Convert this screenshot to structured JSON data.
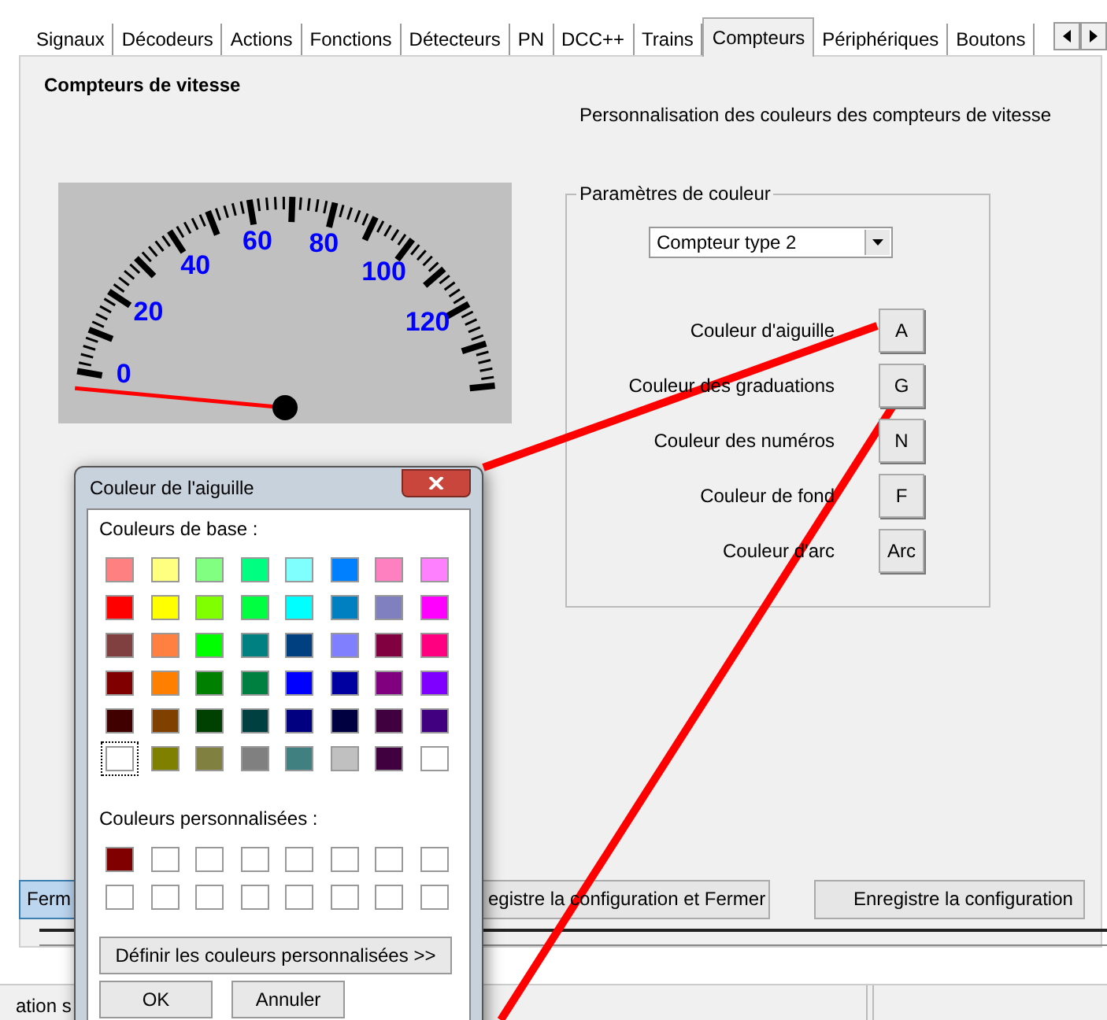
{
  "tabs": [
    {
      "label": "Signaux",
      "selected": false
    },
    {
      "label": "Décodeurs",
      "selected": false
    },
    {
      "label": "Actions",
      "selected": false
    },
    {
      "label": "Fonctions",
      "selected": false
    },
    {
      "label": "Détecteurs",
      "selected": false
    },
    {
      "label": "PN",
      "selected": false
    },
    {
      "label": "DCC++",
      "selected": false
    },
    {
      "label": "Trains",
      "selected": false
    },
    {
      "label": "Compteurs",
      "selected": true
    },
    {
      "label": "Périphériques",
      "selected": false
    },
    {
      "label": "Boutons",
      "selected": false
    }
  ],
  "page": {
    "title": "Compteurs de vitesse",
    "subtitle": "Personnalisation des couleurs des compteurs de vitesse"
  },
  "gauge": {
    "labels": [
      "0",
      "20",
      "40",
      "60",
      "80",
      "100",
      "120"
    ]
  },
  "color_group": {
    "legend": "Paramètres de couleur",
    "dropdown": "Compteur type 2",
    "rows": [
      {
        "label": "Couleur d'aiguille",
        "button": "A"
      },
      {
        "label": "Couleur des graduations",
        "button": "G"
      },
      {
        "label": "Couleur des numéros",
        "button": "N"
      },
      {
        "label": "Couleur  de fond",
        "button": "F"
      },
      {
        "label": "Couleur d'arc",
        "button": "Arc"
      }
    ]
  },
  "bottom_buttons": [
    {
      "label": "Ferm",
      "focused": true
    },
    {
      "label": "egistre la configuration et Fermer",
      "focused": false
    },
    {
      "label": "Enregistre la configuration",
      "focused": false
    }
  ],
  "status_bar": {
    "text": "ation s"
  },
  "dialog": {
    "title": "Couleur de l'aiguille",
    "base_label": "Couleurs de base :",
    "base_colors": [
      {
        "color": "#ff8080",
        "selected": false
      },
      {
        "color": "#ffff80",
        "selected": false
      },
      {
        "color": "#80ff80",
        "selected": false
      },
      {
        "color": "#00ff80",
        "selected": false
      },
      {
        "color": "#80ffff",
        "selected": false
      },
      {
        "color": "#0080ff",
        "selected": false
      },
      {
        "color": "#ff80c0",
        "selected": false
      },
      {
        "color": "#ff80ff",
        "selected": false
      },
      {
        "color": "#ff0000",
        "selected": false
      },
      {
        "color": "#ffff00",
        "selected": false
      },
      {
        "color": "#80ff00",
        "selected": false
      },
      {
        "color": "#00ff40",
        "selected": false
      },
      {
        "color": "#00ffff",
        "selected": false
      },
      {
        "color": "#0080c0",
        "selected": false
      },
      {
        "color": "#8080c0",
        "selected": false
      },
      {
        "color": "#ff00ff",
        "selected": false
      },
      {
        "color": "#804040",
        "selected": false
      },
      {
        "color": "#ff8040",
        "selected": false
      },
      {
        "color": "#00ff00",
        "selected": false
      },
      {
        "color": "#008080",
        "selected": false
      },
      {
        "color": "#004080",
        "selected": false
      },
      {
        "color": "#8080ff",
        "selected": false
      },
      {
        "color": "#800040",
        "selected": false
      },
      {
        "color": "#ff0080",
        "selected": false
      },
      {
        "color": "#800000",
        "selected": false
      },
      {
        "color": "#ff8000",
        "selected": false
      },
      {
        "color": "#008000",
        "selected": false
      },
      {
        "color": "#008040",
        "selected": false
      },
      {
        "color": "#0000ff",
        "selected": false
      },
      {
        "color": "#0000a0",
        "selected": false
      },
      {
        "color": "#800080",
        "selected": false
      },
      {
        "color": "#8000ff",
        "selected": false
      },
      {
        "color": "#400000",
        "selected": false
      },
      {
        "color": "#804000",
        "selected": false
      },
      {
        "color": "#004000",
        "selected": false
      },
      {
        "color": "#004040",
        "selected": false
      },
      {
        "color": "#000080",
        "selected": false
      },
      {
        "color": "#000040",
        "selected": false
      },
      {
        "color": "#400040",
        "selected": false
      },
      {
        "color": "#400080",
        "selected": false
      },
      {
        "color": "#ffffff",
        "selected": true
      },
      {
        "color": "#808000",
        "selected": false
      },
      {
        "color": "#808040",
        "selected": false
      },
      {
        "color": "#808080",
        "selected": false
      },
      {
        "color": "#408080",
        "selected": false
      },
      {
        "color": "#c0c0c0",
        "selected": false
      },
      {
        "color": "#400040",
        "selected": false
      },
      {
        "color": "#ffffff",
        "selected": false
      }
    ],
    "custom_label": "Couleurs personnalisées :",
    "custom_colors": [
      {
        "color": "#800000"
      },
      {
        "color": "#ffffff"
      },
      {
        "color": "#ffffff"
      },
      {
        "color": "#ffffff"
      },
      {
        "color": "#ffffff"
      },
      {
        "color": "#ffffff"
      },
      {
        "color": "#ffffff"
      },
      {
        "color": "#ffffff"
      },
      {
        "color": "#ffffff"
      },
      {
        "color": "#ffffff"
      },
      {
        "color": "#ffffff"
      },
      {
        "color": "#ffffff"
      },
      {
        "color": "#ffffff"
      },
      {
        "color": "#ffffff"
      },
      {
        "color": "#ffffff"
      },
      {
        "color": "#ffffff"
      }
    ],
    "define_button": "Définir les couleurs personnalisées >>",
    "ok": "OK",
    "cancel": "Annuler"
  }
}
